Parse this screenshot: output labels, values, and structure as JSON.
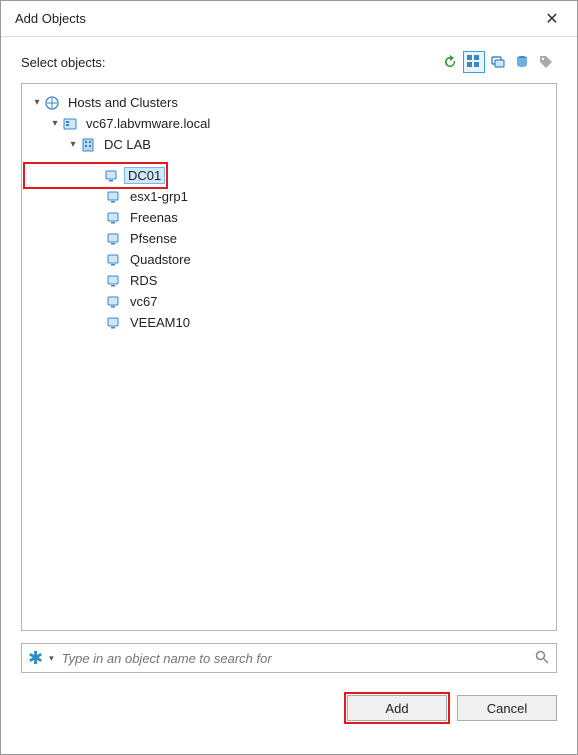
{
  "window": {
    "title": "Add Objects"
  },
  "header": {
    "select_objects": "Select objects:"
  },
  "views": {
    "refresh": "refresh",
    "hosts_clusters": "hosts-clusters",
    "vms_templates": "vms-templates",
    "datastores": "datastores",
    "tags": "tags",
    "selected_index": 1
  },
  "tree": {
    "root": {
      "label": "Hosts and Clusters",
      "expanded": true,
      "type": "hosts-clusters",
      "children": [
        {
          "label": "vc67.labvmware.local",
          "expanded": true,
          "type": "vcenter",
          "children": [
            {
              "label": "DC LAB",
              "expanded": true,
              "type": "datacenter",
              "children": [
                {
                  "label": "DC01",
                  "type": "vm",
                  "selected": true,
                  "highlighted": true
                },
                {
                  "label": "esx1-grp1",
                  "type": "vm"
                },
                {
                  "label": "Freenas",
                  "type": "vm"
                },
                {
                  "label": "Pfsense",
                  "type": "vm"
                },
                {
                  "label": "Quadstore",
                  "type": "vm"
                },
                {
                  "label": "RDS",
                  "type": "vm"
                },
                {
                  "label": "vc67",
                  "type": "vm"
                },
                {
                  "label": "VEEAM10",
                  "type": "vm"
                }
              ]
            }
          ]
        }
      ]
    }
  },
  "search": {
    "placeholder": "Type in an object name to search for"
  },
  "buttons": {
    "add": "Add",
    "cancel": "Cancel",
    "highlight": "add"
  }
}
